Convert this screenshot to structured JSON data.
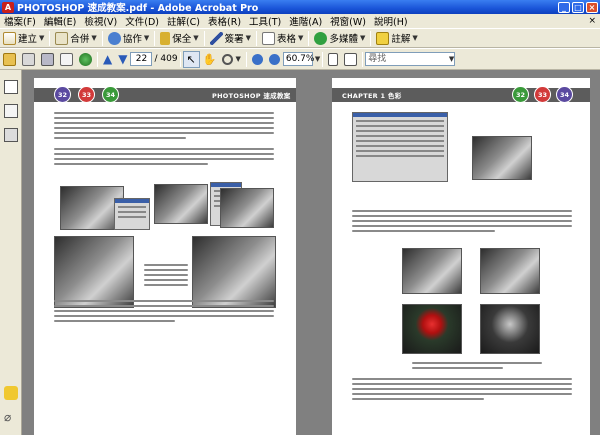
{
  "window": {
    "title": "PHOTOSHOP 速成教案.pdf - Adobe Acrobat Pro",
    "app_icon_label": "A"
  },
  "menu": {
    "items": [
      "檔案(F)",
      "編輯(E)",
      "檢視(V)",
      "文件(D)",
      "註解(C)",
      "表格(R)",
      "工具(T)",
      "進階(A)",
      "視窗(W)",
      "說明(H)"
    ],
    "close_glyph": "×"
  },
  "toolbar1": {
    "create": "建立",
    "combine": "合併",
    "collaborate": "協作",
    "secure": "保全",
    "sign": "簽署",
    "forms": "表格",
    "multimedia": "多媒體",
    "comment": "註解"
  },
  "toolbar2": {
    "page_current": "22",
    "page_total": "/ 409",
    "zoom": "60.7%",
    "search_placeholder": "尋找"
  },
  "left_page": {
    "page_numbers": [
      "32",
      "33",
      "34"
    ],
    "header_title": "PHOTOSHOP 速成教案",
    "circle_colors": [
      "#5b4aa0",
      "#d23a3a",
      "#3a9a3a"
    ]
  },
  "right_page": {
    "chapter": "CHAPTER 1 色彩",
    "page_numbers": [
      "32",
      "33",
      "34"
    ],
    "circle_colors": [
      "#3a9a3a",
      "#d23a3a",
      "#5b4aa0"
    ]
  },
  "colors": {
    "titlebar": "#1a55d8",
    "chrome": "#ece9d8",
    "doc_bg": "#808080"
  },
  "icons": [
    "app-icon",
    "create-icon",
    "combine-icon",
    "collaborate-icon",
    "secure-icon",
    "sign-icon",
    "forms-icon",
    "multimedia-icon",
    "comment-icon",
    "open-icon",
    "print-icon",
    "save-icon",
    "email-icon",
    "prev-page-icon",
    "next-page-icon",
    "select-icon",
    "hand-icon",
    "zoom-icon",
    "zoom-out-icon",
    "zoom-in-icon",
    "pages-icon",
    "bookmarks-icon",
    "signatures-icon",
    "attachments-icon",
    "comments-panel-icon"
  ]
}
